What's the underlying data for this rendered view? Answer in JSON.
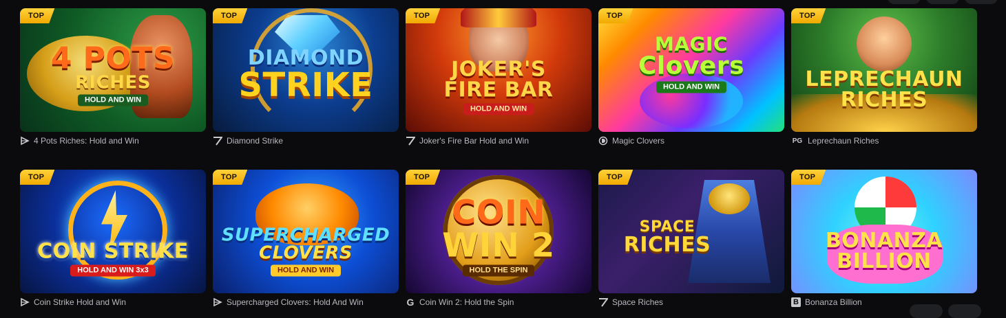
{
  "badge_label": "TOP",
  "games": [
    {
      "title": "4 Pots Riches: Hold and Win",
      "provider_icon": "play-triangle-icon",
      "logo": {
        "line1": "4 POTS",
        "line2": "RICHES",
        "sub": "HOLD AND WIN"
      }
    },
    {
      "title": "Diamond Strike",
      "provider_icon": "seven-icon",
      "logo": {
        "line1": "DIAMOND",
        "line2": "STRIKE",
        "sub": ""
      }
    },
    {
      "title": "Joker's Fire Bar Hold and Win",
      "provider_icon": "seven-icon",
      "logo": {
        "line1": "JOKER'S",
        "line2": "FIRE BAR",
        "sub": "HOLD AND WIN"
      }
    },
    {
      "title": "Magic Clovers",
      "provider_icon": "d-logo-icon",
      "logo": {
        "line1": "MAGIC",
        "line2": "Clovers",
        "sub": "HOLD AND WIN"
      }
    },
    {
      "title": "Leprechaun Riches",
      "provider_icon": "pg-icon",
      "provider_text": "PG",
      "logo": {
        "line1": "LEPRECHAUN",
        "line2": "RICHES",
        "sub": ""
      }
    },
    {
      "title": "Coin Strike Hold and Win",
      "provider_icon": "play-triangle-icon",
      "logo": {
        "line1": "COIN STRIKE",
        "line2": "",
        "sub": "HOLD AND WIN 3x3"
      }
    },
    {
      "title": "Supercharged Clovers: Hold And Win",
      "provider_icon": "play-triangle-icon",
      "logo": {
        "line1": "SUPERCHARGED",
        "line2": "CLOVERS",
        "sub": "HOLD AND WIN"
      }
    },
    {
      "title": "Coin Win 2: Hold the Spin",
      "provider_icon": "g-logo-icon",
      "provider_text": "G",
      "logo": {
        "line1": "COIN",
        "line2": "WIN 2",
        "sub": "HOLD THE SPIN"
      }
    },
    {
      "title": "Space Riches",
      "provider_icon": "seven-icon",
      "logo": {
        "line1": "SPACE",
        "line2": "RICHES",
        "sub": ""
      }
    },
    {
      "title": "Bonanza Billion",
      "provider_icon": "b-logo-icon",
      "provider_text": "B",
      "logo": {
        "line1": "BONANZA",
        "line2": "BILLION",
        "sub": ""
      }
    }
  ]
}
